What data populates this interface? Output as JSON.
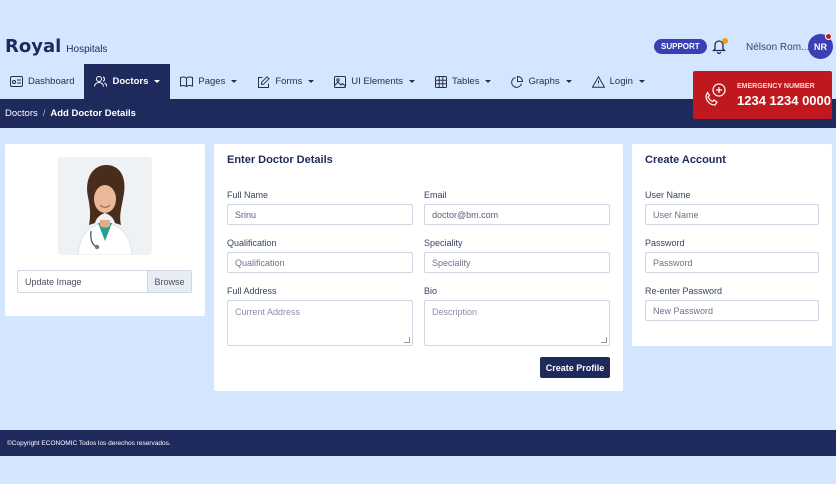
{
  "brand": {
    "name": "Royal",
    "sub": "Hospitals"
  },
  "header": {
    "support_label": "SUPPORT",
    "user_name": "Nélson Rom...",
    "avatar_initials": "NR"
  },
  "nav": {
    "items": [
      {
        "label": "Dashboard",
        "icon": "dashboard-icon",
        "active": false
      },
      {
        "label": "Doctors",
        "icon": "users-icon",
        "active": true
      },
      {
        "label": "Pages",
        "icon": "book-icon",
        "active": false
      },
      {
        "label": "Forms",
        "icon": "edit-icon",
        "active": false
      },
      {
        "label": "UI Elements",
        "icon": "image-icon",
        "active": false
      },
      {
        "label": "Tables",
        "icon": "table-icon",
        "active": false
      },
      {
        "label": "Graphs",
        "icon": "pie-chart-icon",
        "active": false
      },
      {
        "label": "Login",
        "icon": "warning-icon",
        "active": false
      }
    ]
  },
  "emergency": {
    "label": "EMERGENCY NUMBER",
    "number": "1234 1234 0000"
  },
  "breadcrumb": {
    "parent": "Doctors",
    "separator": "/",
    "current": "Add Doctor Details"
  },
  "photo_card": {
    "upload_label": "Update Image",
    "browse_label": "Browse"
  },
  "details": {
    "title": "Enter Doctor Details",
    "full_name_label": "Full Name",
    "full_name_value": "Srinu",
    "email_label": "Email",
    "email_value": "doctor@bm.com",
    "qualification_label": "Qualification",
    "qualification_placeholder": "Qualification",
    "speciality_label": "Speciality",
    "speciality_placeholder": "Speciality",
    "address_label": "Full Address",
    "address_placeholder": "Current Address",
    "bio_label": "Bio",
    "bio_placeholder": "Description",
    "submit_label": "Create Profile"
  },
  "account": {
    "title": "Create Account",
    "username_label": "User Name",
    "username_placeholder": "User Name",
    "password_label": "Password",
    "password_placeholder": "Password",
    "reenter_label": "Re-enter Password",
    "reenter_placeholder": "New Password"
  },
  "footer": {
    "text": "©Copyright ECONOMIC Todos los derechos reservados."
  },
  "colors": {
    "navy": "#1e2a5c",
    "accent": "#3b3fb3",
    "emergency": "#c0181f",
    "background": "#d3e5ff"
  }
}
